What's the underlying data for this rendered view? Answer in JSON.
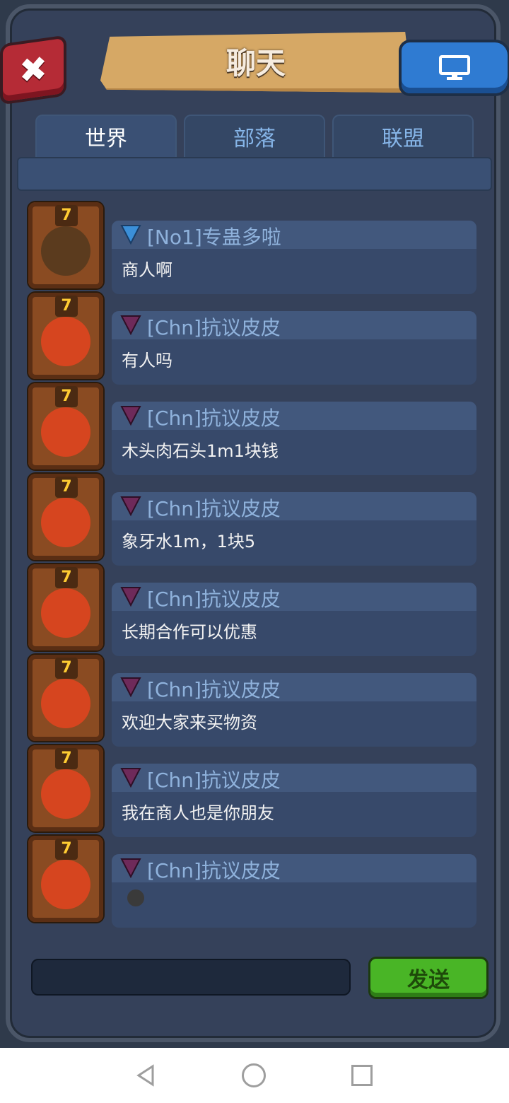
{
  "title": "聊天",
  "tabs": [
    {
      "label": "世界",
      "active": true
    },
    {
      "label": "部落",
      "active": false
    },
    {
      "label": "联盟",
      "active": false
    }
  ],
  "messages": [
    {
      "name": "[No1]专蛊多啦",
      "text": "商人啊",
      "level": "7",
      "shield": "blue",
      "avatar": "bearded-man"
    },
    {
      "name": "[Chn]抗议皮皮",
      "text": "有人吗",
      "level": "7",
      "shield": "purple",
      "avatar": "red-haired-woman"
    },
    {
      "name": "[Chn]抗议皮皮",
      "text": "木头肉石头1m1块钱",
      "level": "7",
      "shield": "purple",
      "avatar": "red-haired-woman"
    },
    {
      "name": "[Chn]抗议皮皮",
      "text": "象牙水1m，1块5",
      "level": "7",
      "shield": "purple",
      "avatar": "red-haired-woman"
    },
    {
      "name": "[Chn]抗议皮皮",
      "text": "长期合作可以优惠",
      "level": "7",
      "shield": "purple",
      "avatar": "red-haired-woman"
    },
    {
      "name": "[Chn]抗议皮皮",
      "text": "欢迎大家来买物资",
      "level": "7",
      "shield": "purple",
      "avatar": "red-haired-woman"
    },
    {
      "name": "[Chn]抗议皮皮",
      "text": "我在商人也是你朋友",
      "level": "7",
      "shield": "purple",
      "avatar": "red-haired-woman"
    },
    {
      "name": "[Chn]抗议皮皮",
      "text": "",
      "emoji": "dark-face-emoji",
      "level": "7",
      "shield": "purple",
      "avatar": "red-haired-woman"
    }
  ],
  "input": {
    "placeholder": ""
  },
  "send_label": "发送",
  "colors": {
    "send": "#49b526",
    "close": "#b52b36",
    "screen": "#2f7bd2",
    "tab_active_text": "#ffffff",
    "tab_text": "#86b5e8"
  }
}
